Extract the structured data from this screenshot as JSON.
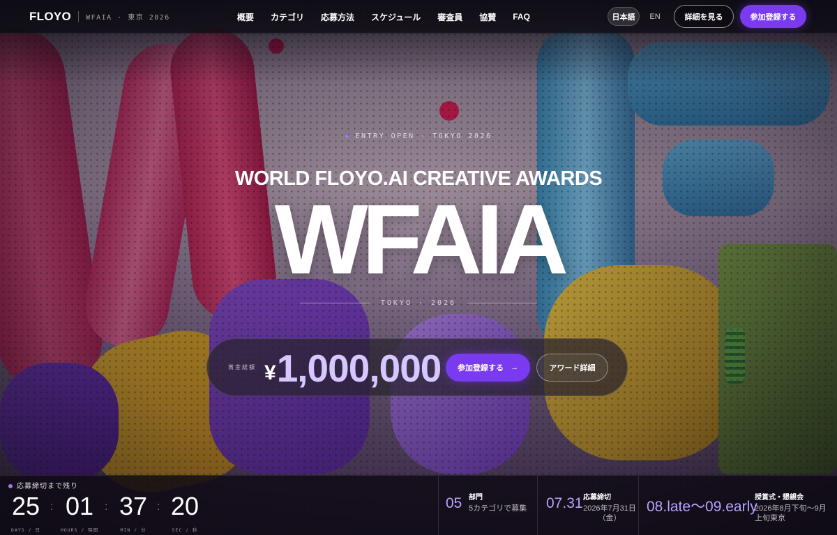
{
  "header": {
    "logo": "FLOYO",
    "edition": "WFAIA · 東京 2026",
    "nav": [
      "概要",
      "カテゴリ",
      "応募方法",
      "スケジュール",
      "審査員",
      "協賛",
      "FAQ"
    ],
    "lang_ja": "日本語",
    "lang_en": "EN",
    "detail_button": "詳細を見る",
    "register_button": "参加登録する"
  },
  "hero": {
    "eyebrow": "ENTRY OPEN · TOKYO 2026",
    "subtitle": "WORLD FLOYO.AI CREATIVE AWARDS",
    "title": "WFAIA",
    "city": "TOKYO · 2026",
    "prize_label": "賞金総額",
    "prize_currency": "¥",
    "prize_amount": "1,000,000",
    "register_button": "参加登録する",
    "register_arrow": "→",
    "award_button": "アワード詳細"
  },
  "countdown": {
    "label": "応募締切まで残り",
    "units": [
      {
        "value": "25",
        "caption": "DAYS / 日"
      },
      {
        "value": "01",
        "caption": "HOURS / 時間"
      },
      {
        "value": "37",
        "caption": "MIN / 分"
      },
      {
        "value": "20",
        "caption": "SEC / 秒"
      }
    ],
    "separator": ":"
  },
  "stats": [
    {
      "value": "05",
      "title": "部門",
      "desc": "5カテゴリで募集"
    },
    {
      "value": "07.31",
      "title": "応募締切",
      "desc": "2026年7月31日（金）"
    },
    {
      "value": "08.late〜09.early",
      "title": "授賞式・懇親会",
      "desc": "2026年8月下旬〜9月上旬東京"
    }
  ],
  "colors": {
    "accent": "#7a3af0",
    "accent_light": "#b9a2ff",
    "prize_text": "#d5c7ff"
  }
}
